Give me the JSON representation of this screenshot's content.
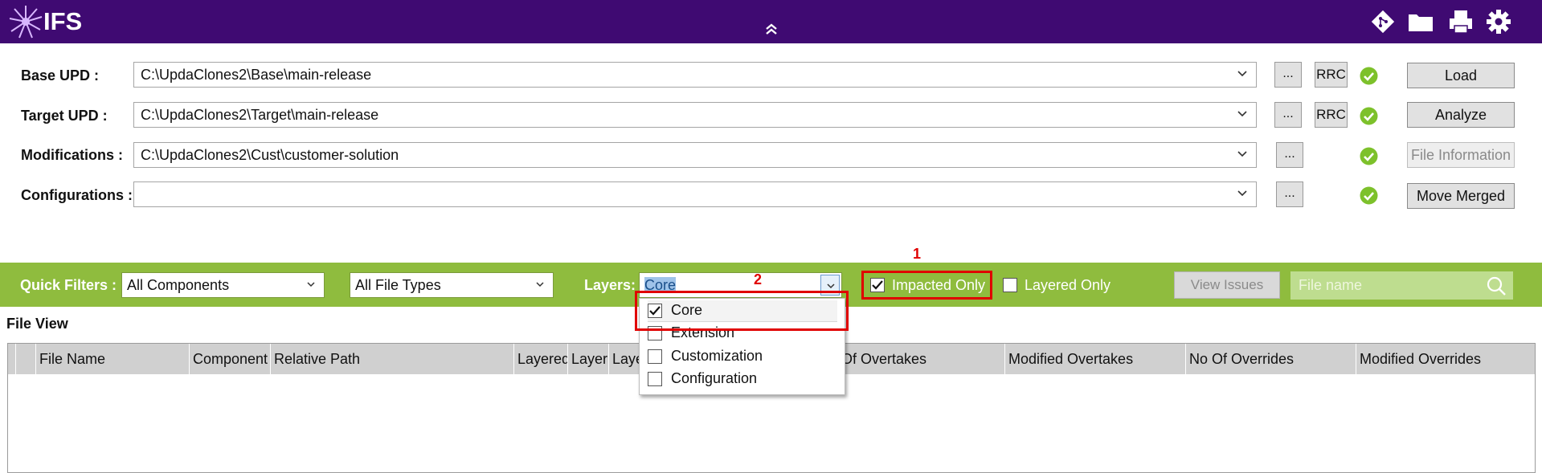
{
  "header": {
    "logo_text": "IFS",
    "icons": [
      "git-icon",
      "folder-icon",
      "printer-icon",
      "gear-icon"
    ]
  },
  "form": {
    "base": {
      "label": "Base UPD :",
      "value": "C:\\UpdaClones2\\Base\\main-release",
      "browse": "...",
      "rrc": "RRC",
      "action": "Load"
    },
    "target": {
      "label": "Target UPD :",
      "value": "C:\\UpdaClones2\\Target\\main-release",
      "browse": "...",
      "rrc": "RRC",
      "action": "Analyze"
    },
    "mods": {
      "label": "Modifications :",
      "value": "C:\\UpdaClones2\\Cust\\customer-solution",
      "browse": "...",
      "action": "File Information"
    },
    "configs": {
      "label": "Configurations :",
      "value": "",
      "browse": "...",
      "action": "Move Merged"
    }
  },
  "filters": {
    "label": "Quick Filters :",
    "components": "All Components",
    "file_types": "All File Types",
    "layers_label": "Layers:",
    "layers_value": "Core",
    "impacted_only": "Impacted Only",
    "layered_only": "Layered Only",
    "view_issues": "View Issues",
    "search_placeholder": "File name"
  },
  "annotations": {
    "one": "1",
    "two": "2"
  },
  "layers_options": [
    {
      "label": "Core",
      "checked": true
    },
    {
      "label": "Extension",
      "checked": false
    },
    {
      "label": "Customization",
      "checked": false
    },
    {
      "label": "Configuration",
      "checked": false
    }
  ],
  "file_view": {
    "title": "File View",
    "columns": [
      "File Name",
      "Component",
      "Relative Path",
      "Layered",
      "Layer",
      "Laye",
      "No Of Overtakes",
      "Modified Overtakes",
      "No Of Overrides",
      "Modified Overrides"
    ]
  },
  "colors": {
    "topbar": "#3f0a72",
    "filterbar": "#8fbc3e",
    "ok_green": "#7dc12b",
    "annotation_red": "#e00000"
  }
}
